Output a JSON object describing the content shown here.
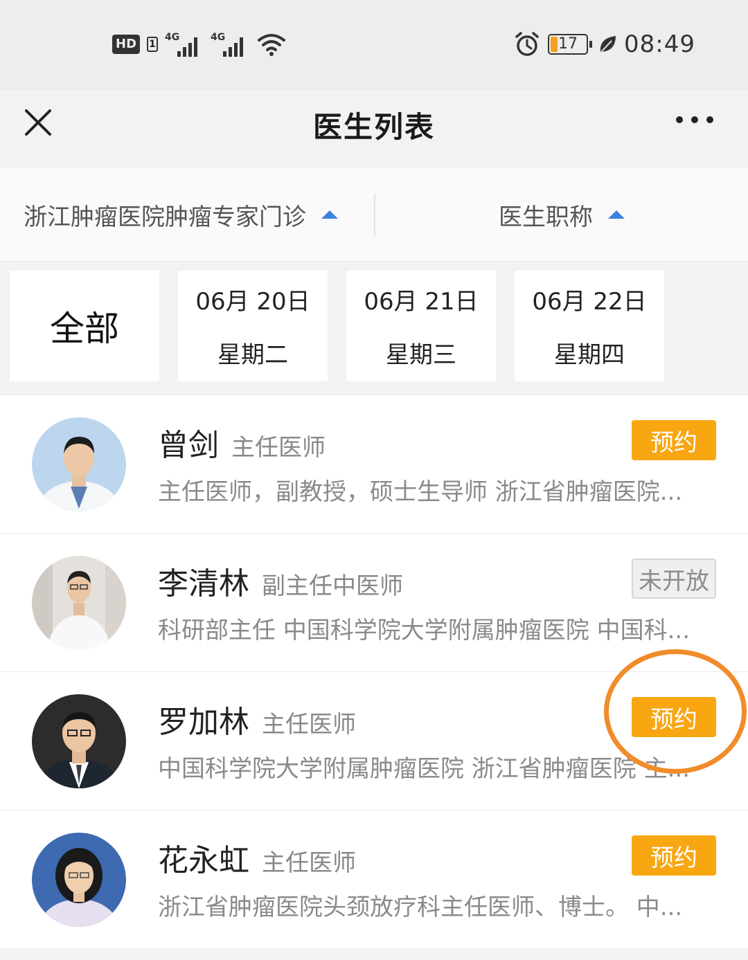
{
  "status_bar": {
    "hd": "HD",
    "sim": "1",
    "network1": "4G",
    "network2": "4G",
    "battery": "17",
    "time": "08:49"
  },
  "nav": {
    "title": "医生列表"
  },
  "filters": {
    "department": "浙江肿瘤医院肿瘤专家门诊",
    "doctor_title": "医生职称"
  },
  "dates": {
    "all": "全部",
    "items": [
      {
        "date": "06月 20日",
        "weekday": "星期二"
      },
      {
        "date": "06月 21日",
        "weekday": "星期三"
      },
      {
        "date": "06月 22日",
        "weekday": "星期四"
      }
    ]
  },
  "doctors": [
    {
      "name": "曾剑",
      "title": "主任医师",
      "desc": "主任医师，副教授，硕士生导师 浙江省肿瘤医院...",
      "button": "预约",
      "status": "book"
    },
    {
      "name": "李清林",
      "title": "副主任中医师",
      "desc": "科研部主任 中国科学院大学附属肿瘤医院 中国科...",
      "button": "未开放",
      "status": "closed"
    },
    {
      "name": "罗加林",
      "title": "主任医师",
      "desc": "中国科学院大学附属肿瘤医院 浙江省肿瘤医院 主...",
      "button": "预约",
      "status": "book"
    },
    {
      "name": "花永虹",
      "title": "主任医师",
      "desc": "浙江省肿瘤医院头颈放疗科主任医师、博士。 中...",
      "button": "预约",
      "status": "book"
    }
  ],
  "colors": {
    "accent_orange": "#f8a612",
    "highlight_ring": "#f08c2a",
    "triangle_blue": "#3b82e0"
  }
}
